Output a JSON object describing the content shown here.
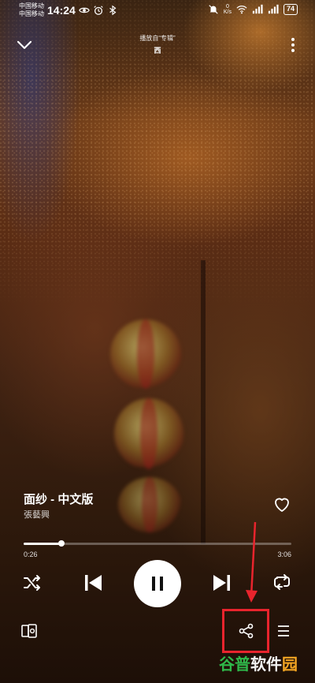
{
  "status_bar": {
    "carrier_1": "中国移动",
    "carrier_2": "中国移动",
    "time": "14:24",
    "net_speed_value": "0",
    "net_speed_unit": "K/s",
    "signal_1_label": "4G",
    "signal_2_label": "4G",
    "battery": "74"
  },
  "header": {
    "playing_from": "播放自“专辑”",
    "album": "西",
    "collapse_icon": "chevron-down-icon",
    "more_icon": "more-vertical-icon"
  },
  "track": {
    "title": "面纱 - 中文版",
    "artist": "張藝興",
    "liked": false
  },
  "progress": {
    "elapsed": "0:26",
    "total": "3:06",
    "fraction": 0.14
  },
  "controls": {
    "shuffle_icon": "shuffle-icon",
    "previous_icon": "skip-previous-icon",
    "play_state": "playing",
    "pause_icon": "pause-icon",
    "next_icon": "skip-next-icon",
    "repeat_icon": "repeat-icon"
  },
  "bottom_bar": {
    "devices_icon": "connect-device-icon",
    "share_icon": "share-icon",
    "queue_icon": "queue-icon"
  },
  "annotation": {
    "color": "#e8242d"
  },
  "watermark": {
    "part_1": "谷普",
    "part_2": "软件",
    "part_3": "园"
  }
}
